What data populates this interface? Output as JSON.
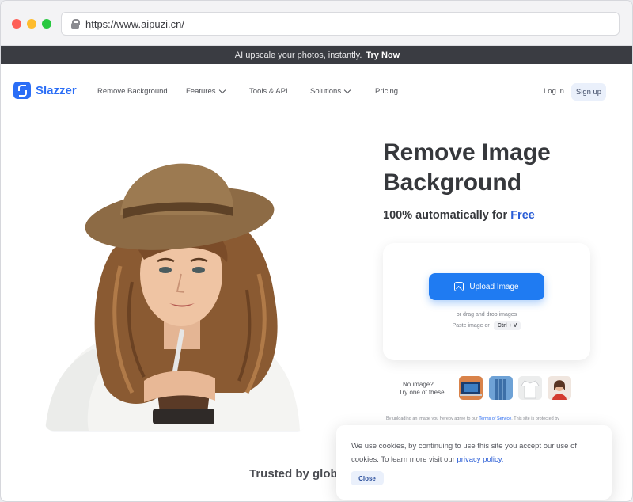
{
  "browser": {
    "url": "https://www.aipuzi.cn/"
  },
  "announcement": {
    "text": "AI upscale your photos, instantly.",
    "link": "Try Now"
  },
  "nav": {
    "brand": "Slazzer",
    "items": [
      {
        "label": "Remove Background",
        "has_dropdown": false
      },
      {
        "label": "Features",
        "has_dropdown": true
      },
      {
        "label": "Tools & API",
        "has_dropdown": false
      },
      {
        "label": "Solutions",
        "has_dropdown": true
      },
      {
        "label": "Pricing",
        "has_dropdown": false
      }
    ],
    "login": "Log in",
    "signup": "Sign up"
  },
  "hero": {
    "headline_line1": "Remove Image",
    "headline_line2": "Background",
    "subline_prefix": "100% automatically for",
    "subline_free": "Free"
  },
  "upload": {
    "button": "Upload Image",
    "drag_text": "or drag and drop images",
    "paste_text": "Paste image or",
    "shortcut": "Ctrl + V"
  },
  "samples": {
    "line1": "No image?",
    "line2": "Try one of these:",
    "items": [
      "laptop-sample",
      "building-sample",
      "shirt-sample",
      "woman-sample"
    ]
  },
  "terms": {
    "prefix": "By uploading an image you hereby agree to our",
    "link": "Terms of Service",
    "suffix": ". This site is protected by"
  },
  "trusted": "Trusted by glob",
  "cookie": {
    "text": "We use cookies, by continuing to use this site you accept our use of cookies.  To learn more visit our",
    "link": "privacy policy.",
    "close": "Close"
  },
  "colors": {
    "brand": "#2b6ef6",
    "upload_button": "#1f7bf2",
    "announce_bg": "#3a3c42",
    "text_dark": "#36383c"
  }
}
